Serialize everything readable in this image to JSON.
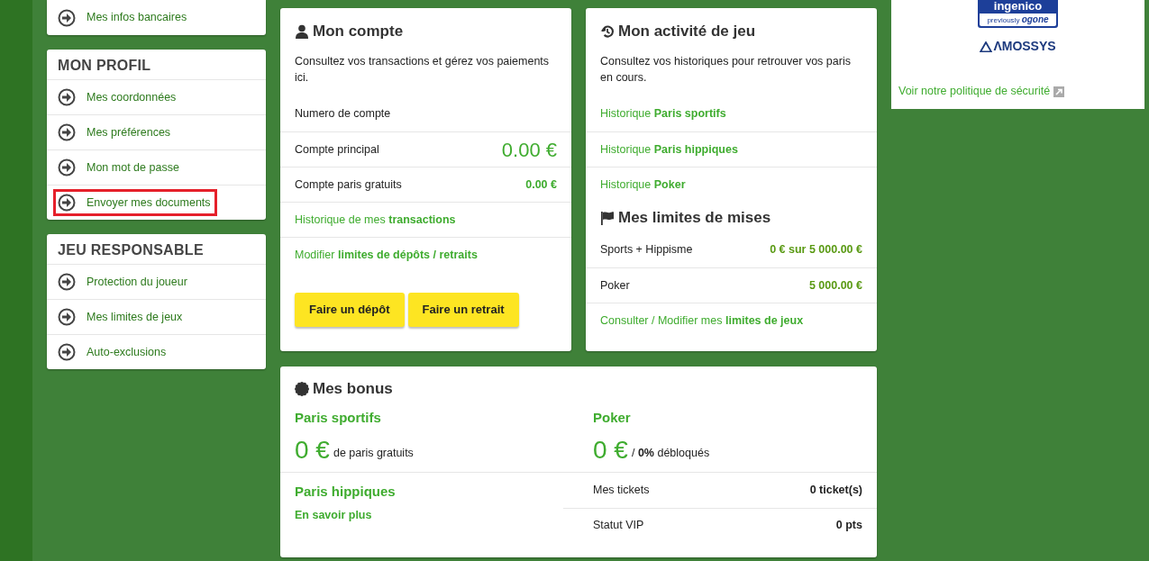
{
  "sidebar": [
    {
      "items": [
        {
          "label": "Mes infos bancaires",
          "highlighted": false
        }
      ]
    },
    {
      "title": "MON PROFIL",
      "items": [
        {
          "label": "Mes coordonnées",
          "highlighted": false
        },
        {
          "label": "Mes préférences",
          "highlighted": false
        },
        {
          "label": "Mon mot de passe",
          "highlighted": false
        },
        {
          "label": "Envoyer mes documents",
          "highlighted": true
        }
      ]
    },
    {
      "title": "JEU RESPONSABLE",
      "items": [
        {
          "label": "Protection du joueur",
          "highlighted": false
        },
        {
          "label": "Mes limites de jeux",
          "highlighted": false
        },
        {
          "label": "Auto-exclusions",
          "highlighted": false
        }
      ]
    }
  ],
  "account": {
    "title": "Mon compte",
    "intro": "Consultez vos transactions et gérez vos paiements ici.",
    "rows": [
      {
        "kind": "plain",
        "label": "Numero de compte"
      },
      {
        "kind": "big-amount",
        "label": "Compte principal",
        "value": "0.00 €"
      },
      {
        "kind": "amount",
        "label": "Compte paris gratuits",
        "value": "0.00 €"
      },
      {
        "kind": "link",
        "label": "Historique de mes **transactions**"
      },
      {
        "kind": "link",
        "label": "Modifier **limites de dépôts / retraits**"
      }
    ],
    "buttons": [
      "Faire un dépôt",
      "Faire un retrait"
    ]
  },
  "activity": {
    "title": "Mon activité de jeu",
    "intro": "Consultez vos historiques pour retrouver vos paris en cours.",
    "links": [
      "Historique **Paris sportifs**",
      "Historique **Paris hippiques**",
      "Historique **Poker**"
    ],
    "limits_title": "Mes limites de mises",
    "limits": [
      {
        "label": "Sports + Hippisme",
        "value": "0 € sur 5 000.00 €"
      },
      {
        "label": "Poker",
        "value": "5 000.00 €"
      }
    ],
    "limits_link": "Consulter / Modifier mes **limites de jeux**"
  },
  "bonus": {
    "title": "Mes bonus",
    "sports": {
      "title": "Paris sportifs",
      "amount": "0 €",
      "caption": "de paris gratuits"
    },
    "poker": {
      "title": "Poker",
      "amount": "0 €",
      "caption": "/ **0%** débloqués"
    },
    "horses": {
      "title": "Paris hippiques",
      "link": "En savoir plus"
    },
    "stats": [
      {
        "label": "Mes tickets",
        "value": "0 ticket(s)"
      },
      {
        "label": "Statut VIP",
        "value": "0 pts"
      }
    ]
  },
  "security": {
    "logo_1": {
      "name": "ingenico",
      "line": "previously",
      "brand": "ogone"
    },
    "logo_2": "ΛMOSSYS",
    "link": "Voir notre politique de sécurité"
  }
}
